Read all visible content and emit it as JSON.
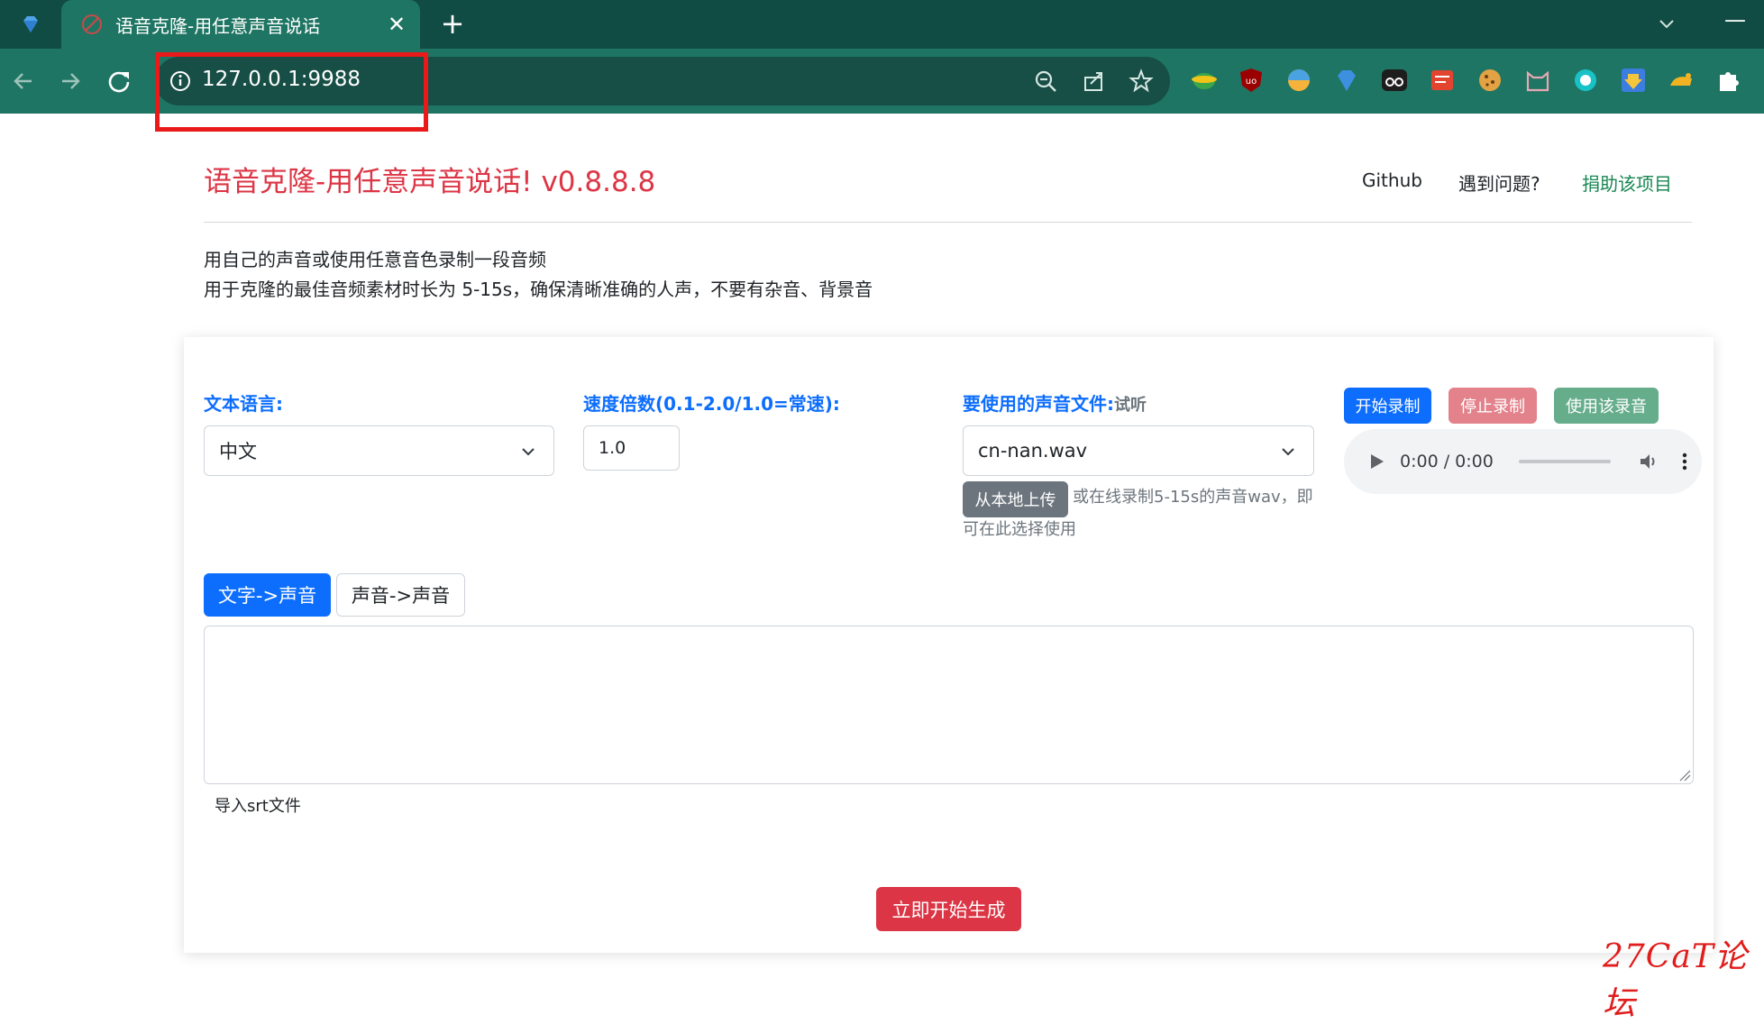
{
  "browser": {
    "tab_title": "语音克隆-用任意声音说话",
    "tab_close": "✕",
    "new_tab": "+",
    "url": "127.0.0.1:9988",
    "annotation_color": "#ea1a1a",
    "icons": [
      "back-arrow-icon",
      "forward-arrow-icon",
      "reload-icon",
      "info-icon",
      "zoom-out-icon",
      "share-icon",
      "star-icon"
    ],
    "extensions": [
      "globe-extension-icon",
      "ublock-extension-icon",
      "colorful-extension-icon",
      "diamond-extension-icon",
      "glasses-extension-icon",
      "red-notes-extension-icon",
      "cookie-extension-icon",
      "cat-extension-icon",
      "teal-circle-extension-icon",
      "download-extension-icon",
      "cat-paw-extension-icon",
      "puzzle-extensions-icon"
    ]
  },
  "header": {
    "brand": "语音克隆-用任意声音说话! v0.8.8.8",
    "nav": [
      "Github",
      "遇到问题?",
      "捐助该项目"
    ]
  },
  "intro": {
    "line1": "用自己的声音或使用任意音色录制一段音频",
    "line2": "用于克隆的最佳音频素材时长为 5-15s，确保清晰准确的人声，不要有杂音、背景音"
  },
  "form": {
    "language_label": "文本语言:",
    "language_value": "中文",
    "speed_label": "速度倍数(0.1-2.0/1.0=常速):",
    "speed_value": "1.0",
    "voice_label": "要使用的声音文件:",
    "voice_preview": "试听",
    "voice_value": "cn-nan.wav",
    "upload_button": "从本地上传",
    "upload_hint_line1": "或在线录制5-15s的声音wav，即",
    "upload_hint_line2": "可在此选择使用",
    "record_start": "开始录制",
    "record_stop": "停止录制",
    "record_use": "使用该录音",
    "audio_time": "0:00 / 0:00",
    "mode_tabs": [
      "文字->声音",
      "声音->声音"
    ],
    "textarea_value": "",
    "import_srt": "导入srt文件",
    "generate_button": "立即开始生成"
  },
  "watermark": "27CaT论坛"
}
